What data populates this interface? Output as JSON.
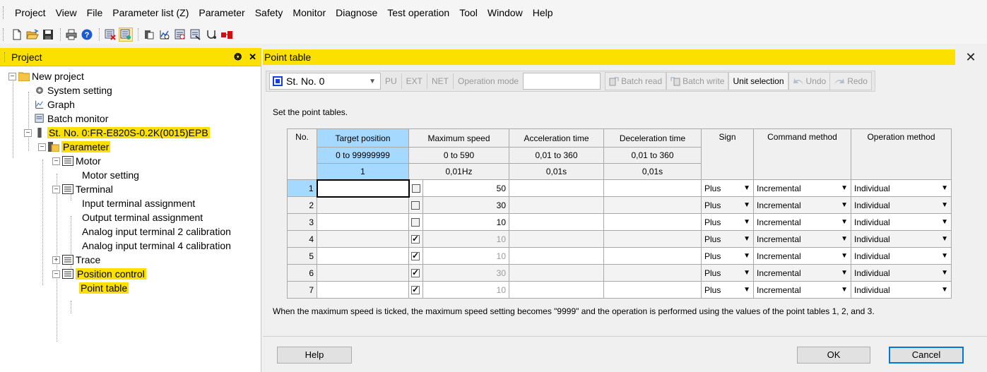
{
  "menubar": {
    "items": [
      "Project",
      "View",
      "File",
      "Parameter list (Z)",
      "Parameter",
      "Safety",
      "Monitor",
      "Diagnose",
      "Test operation",
      "Tool",
      "Window",
      "Help"
    ]
  },
  "project_panel": {
    "title": "Project",
    "pin_glyph": "❂",
    "close_glyph": "✕",
    "tree": {
      "root": "New project",
      "system_setting": "System setting",
      "graph": "Graph",
      "batch_monitor": "Batch monitor",
      "station": "St. No. 0:FR-E820S-0.2K(0015)EPB",
      "parameter": "Parameter",
      "motor": "Motor",
      "motor_setting": "Motor setting",
      "terminal": "Terminal",
      "input_terminal": "Input terminal assignment",
      "output_terminal": "Output terminal assignment",
      "analog2": "Analog input terminal 2 calibration",
      "analog4": "Analog input terminal 4 calibration",
      "trace": "Trace",
      "position_control": "Position control",
      "point_table": "Point table"
    }
  },
  "window": {
    "title": "Point table",
    "close_glyph": "✕"
  },
  "pt_toolbar": {
    "station": "St. No. 0",
    "pu": "PU",
    "ext": "EXT",
    "net": "NET",
    "operation_mode": "Operation mode",
    "batch_read": "Batch read",
    "batch_write": "Batch write",
    "unit_selection": "Unit selection",
    "undo": "Undo",
    "redo": "Redo"
  },
  "description": "Set the point tables.",
  "table": {
    "headers": {
      "no": "No.",
      "target": "Target position",
      "max_speed": "Maximum speed",
      "accel": "Acceleration time",
      "decel": "Deceleration time",
      "sign": "Sign",
      "command": "Command method",
      "operation": "Operation method"
    },
    "ranges": {
      "target": "0 to 99999999",
      "max_speed": "0 to 590",
      "accel": "0,01 to 360",
      "decel": "0,01 to 360"
    },
    "units": {
      "target": "1",
      "max_speed": "0,01Hz",
      "accel": "0,01s",
      "decel": "0,01s"
    },
    "rows": [
      {
        "no": "1",
        "speed": "50",
        "sign": "Plus",
        "command": "Incremental",
        "operation": "Individual"
      },
      {
        "no": "2",
        "speed": "30",
        "sign": "Plus",
        "command": "Incremental",
        "operation": "Individual"
      },
      {
        "no": "3",
        "speed": "10",
        "sign": "Plus",
        "command": "Incremental",
        "operation": "Individual"
      },
      {
        "no": "4",
        "speed": "10",
        "sign": "Plus",
        "command": "Incremental",
        "operation": "Individual"
      },
      {
        "no": "5",
        "speed": "10",
        "sign": "Plus",
        "command": "Incremental",
        "operation": "Individual"
      },
      {
        "no": "6",
        "speed": "30",
        "sign": "Plus",
        "command": "Incremental",
        "operation": "Individual"
      },
      {
        "no": "7",
        "speed": "10",
        "sign": "Plus",
        "command": "Incremental",
        "operation": "Individual"
      }
    ]
  },
  "note": "When the maximum speed is ticked, the maximum speed setting becomes \"9999\" and the operation is performed using the values of the point tables 1, 2, and 3.",
  "footer": {
    "help": "Help",
    "ok": "OK",
    "cancel": "Cancel"
  },
  "colors": {
    "highlight": "#fce100",
    "selection": "#a6d9ff",
    "default_button_border": "#0078d7"
  }
}
